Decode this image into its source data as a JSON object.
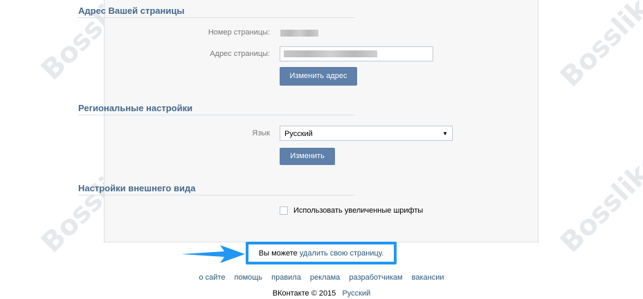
{
  "watermark": "Bosslike",
  "address_section": {
    "title": "Адрес Вашей страницы",
    "page_number_label": "Номер страницы:",
    "page_address_label": "Адрес страницы:",
    "change_address_button": "Изменить адрес"
  },
  "regional_section": {
    "title": "Региональные настройки",
    "language_label": "Язык",
    "language_value": "Русский",
    "change_button": "Изменить"
  },
  "appearance_section": {
    "title": "Настройки внешнего вида",
    "large_fonts_label": "Использовать увеличенные шрифты",
    "large_fonts_checked": false
  },
  "notice": {
    "text": "Вы можете",
    "link": "удалить свою страницу."
  },
  "footer": {
    "links": [
      "о сайте",
      "помощь",
      "правила",
      "реклама",
      "разработчикам",
      "вакансии"
    ],
    "copyright": "ВКонтакте © 2015",
    "language": "Русский"
  },
  "colors": {
    "accent": "#45688e",
    "button": "#5e80aa",
    "highlight": "#2196f3",
    "link": "#2b587a"
  }
}
